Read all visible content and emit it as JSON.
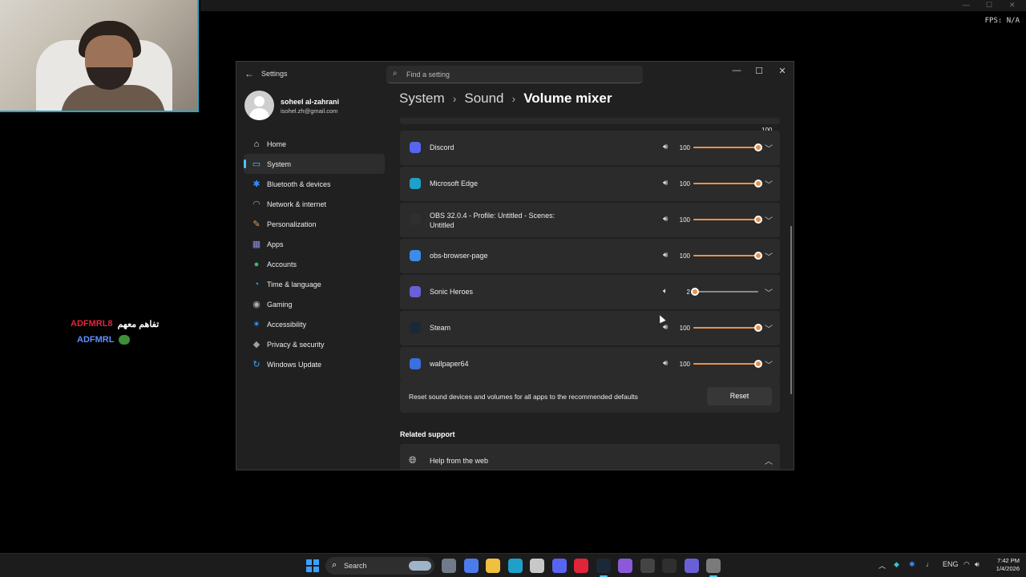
{
  "overlay": {
    "fps": "FPS: N/A",
    "chat": [
      {
        "user": "ADFMRL8",
        "message": "تفاهم معهم"
      },
      {
        "user": "ADFMRL",
        "message": ""
      }
    ]
  },
  "window": {
    "title": "Settings",
    "search_placeholder": "Find a setting",
    "controls": {
      "minimize": "—",
      "maximize": "☐",
      "close": "✕"
    }
  },
  "profile": {
    "name": "soheel al-zahrani",
    "email": "isohel.zh@gmail.com"
  },
  "nav": {
    "items": [
      {
        "label": "Home",
        "icon": "home-icon",
        "color": "#e8e8e8"
      },
      {
        "label": "System",
        "icon": "system-icon",
        "color": "#4cc2ff"
      },
      {
        "label": "Bluetooth & devices",
        "icon": "bluetooth-icon",
        "color": "#3a8bff"
      },
      {
        "label": "Network & internet",
        "icon": "wifi-icon",
        "color": "#5ab0ff"
      },
      {
        "label": "Personalization",
        "icon": "brush-icon",
        "color": "#e0a060"
      },
      {
        "label": "Apps",
        "icon": "apps-icon",
        "color": "#8a8fd8"
      },
      {
        "label": "Accounts",
        "icon": "accounts-icon",
        "color": "#2fbf71"
      },
      {
        "label": "Time & language",
        "icon": "globe-clock-icon",
        "color": "#4aa3e0"
      },
      {
        "label": "Gaming",
        "icon": "gamepad-icon",
        "color": "#b0b0b0"
      },
      {
        "label": "Accessibility",
        "icon": "accessibility-icon",
        "color": "#3a9bff"
      },
      {
        "label": "Privacy & security",
        "icon": "shield-icon",
        "color": "#a0a0a0"
      },
      {
        "label": "Windows Update",
        "icon": "update-icon",
        "color": "#3aa0ff"
      }
    ],
    "active_index": 1
  },
  "breadcrumb": [
    "System",
    "Sound",
    "Volume mixer"
  ],
  "mixer": {
    "header_value": "100",
    "apps": [
      {
        "name": "Discord",
        "volume": "100",
        "level": 1.0,
        "icon": "discord-icon",
        "color": "#5865f2"
      },
      {
        "name": "Microsoft Edge",
        "volume": "100",
        "level": 1.0,
        "icon": "edge-icon",
        "color": "#1fa0c9"
      },
      {
        "name": "OBS 32.0.4 - Profile: Untitled - Scenes: Untitled",
        "volume": "100",
        "level": 1.0,
        "icon": "obs-icon",
        "color": "#2f2f2f"
      },
      {
        "name": "obs-browser-page",
        "volume": "100",
        "level": 1.0,
        "icon": "browser-window-icon",
        "color": "#3b8ee8"
      },
      {
        "name": "Sonic Heroes",
        "volume": "2",
        "level": 0.02,
        "icon": "sonic-heroes-icon",
        "color": "#6b5fd8"
      },
      {
        "name": "Steam",
        "volume": "100",
        "level": 1.0,
        "icon": "steam-icon",
        "color": "#1b2838"
      },
      {
        "name": "wallpaper64",
        "volume": "100",
        "level": 1.0,
        "icon": "wallpaper-engine-icon",
        "color": "#3a6fe0"
      }
    ],
    "accent": "#e8914a"
  },
  "reset": {
    "text": "Reset sound devices and volumes for all apps to the recommended defaults",
    "button": "Reset"
  },
  "related": {
    "heading": "Related support",
    "help": "Help from the web"
  },
  "taskbar": {
    "search_label": "Search",
    "language": "ENG",
    "time": "7:42 PM",
    "date": "1/4/2026",
    "apps": [
      "file-explorer-icon",
      "copilot-icon",
      "folder-icon",
      "edge-icon",
      "store-icon",
      "discord-icon",
      "opera-icon",
      "steam-icon",
      "visual-studio-icon",
      "chatgpt-icon",
      "obs-icon",
      "sonic-heroes-icon",
      "settings-icon"
    ]
  }
}
